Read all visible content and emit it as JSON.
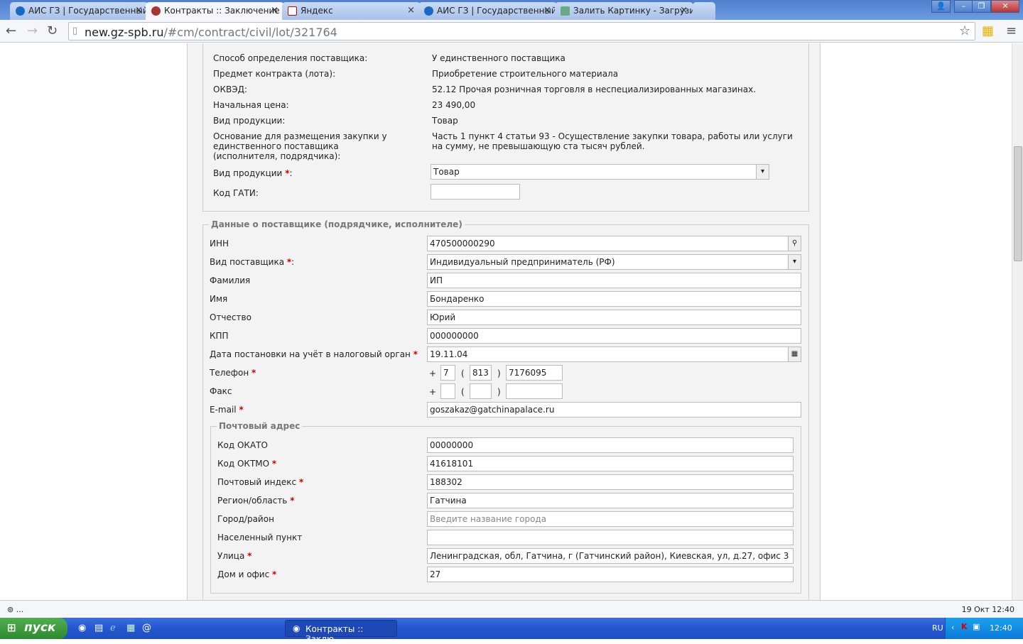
{
  "browser": {
    "tabs": [
      {
        "label": "АИС ГЗ | Государственный"
      },
      {
        "label": "Контракты :: Заключение"
      },
      {
        "label": "Яндекс"
      },
      {
        "label": "АИС ГЗ | Государственный"
      },
      {
        "label": "Залить Картинку - Загрузи"
      }
    ],
    "url_host": "new.gz-spb.ru",
    "url_path": "/#cm/contract/civil/lot/321764"
  },
  "lot": {
    "rows": [
      {
        "label": "Способ определения поставщика:",
        "value": "У единственного поставщика"
      },
      {
        "label": "Предмет контракта (лота):",
        "value": "Приобретение строительного материала"
      },
      {
        "label": "ОКВЭД:",
        "value": "52.12 Прочая розничная торговля в неспециализированных магазинах."
      },
      {
        "label": "Начальная цена:",
        "value": "23 490,00"
      },
      {
        "label": "Вид продукции:",
        "value": "Товар"
      },
      {
        "label": "Основание для размещения закупки у единственного поставщика (исполнителя, подрядчика):",
        "value": "Часть 1 пункт 4 статьи 93 - Осуществление закупки товара, работы или услуги на сумму, не превышающую ста тысяч рублей."
      }
    ],
    "product_type_label": "Вид продукции",
    "product_type_value": "Товар",
    "gati_label": "Код ГАТИ:",
    "gati_value": ""
  },
  "supplier": {
    "legend": "Данные о поставщике (подрядчике, исполнителе)",
    "inn_label": "ИНН",
    "inn": "470500000290",
    "type_label": "Вид поставщика",
    "type": "Индивидуальный предприниматель (РФ)",
    "surname_label": "Фамилия",
    "surname": "ИП",
    "name_label": "Имя",
    "name": "Бондаренко",
    "patronymic_label": "Отчество",
    "patronymic": "Юрий",
    "kpp_label": "КПП",
    "kpp": "000000000",
    "taxdate_label": "Дата постановки на учёт в налоговый орган",
    "taxdate": "19.11.04",
    "phone_label": "Телефон",
    "phone_country": "7",
    "phone_code": "813",
    "phone_number": "7176095",
    "fax_label": "Факс",
    "fax_country": "",
    "fax_code": "",
    "fax_number": "",
    "email_label": "E-mail",
    "email": "goszakaz@gatchinapalace.ru",
    "plus": "+",
    "lpar": "(",
    "rpar": ")",
    "star": "*",
    "colon": ":"
  },
  "address": {
    "legend": "Почтовый адрес",
    "okato_label": "Код ОКАТО",
    "okato": "00000000",
    "oktmo_label": "Код ОКТМО",
    "oktmo": "41618101",
    "zip_label": "Почтовый индекс",
    "zip": "188302",
    "region_label": "Регион/область",
    "region": "Гатчина",
    "city_label": "Город/район",
    "city_placeholder": "Введите название города",
    "settlement_label": "Населенный пункт",
    "settlement": "",
    "street_label": "Улица",
    "street": "Ленинградская, обл, Гатчина, г (Гатчинский район), Киевская, ул, д.27, офис 3",
    "house_label": "Дом и офис",
    "house": "27"
  },
  "status": {
    "left": "⊚ ...",
    "right": "19 Окт 12:40"
  },
  "taskbar": {
    "start": "пуск",
    "item": "Контракты :: Заклю...",
    "lang": "RU",
    "clock": "12:40"
  }
}
